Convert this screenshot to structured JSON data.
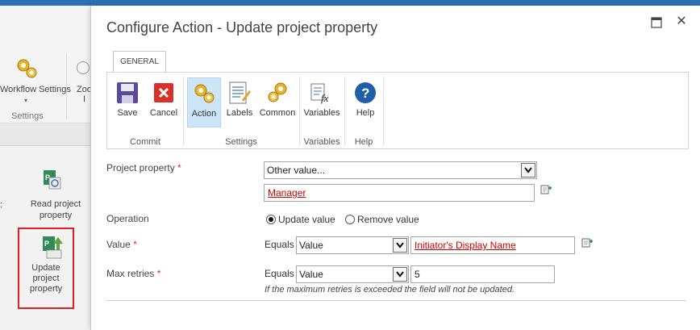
{
  "background": {
    "workflow_settings_label": "Workflow Settings",
    "zoom_label_line1": "Zoo",
    "zoom_label_line2": "I",
    "settings_group_label": "Settings",
    "panel_colon": ":",
    "read_project_property_label": "Read project property",
    "update_project_property_label": "Update project property",
    "highlight_color": "#e02020"
  },
  "dialog": {
    "title": "Configure Action - Update project property",
    "maximize_icon": "maximize-icon",
    "close_icon": "close-icon",
    "close_glyph": "✕"
  },
  "ribbon": {
    "tab": "GENERAL",
    "buttons": {
      "save": "Save",
      "cancel": "Cancel",
      "action": "Action",
      "labels": "Labels",
      "common": "Common",
      "variables": "Variables",
      "help": "Help"
    },
    "groups": {
      "commit": "Commit",
      "settings": "Settings",
      "variables": "Variables",
      "help": "Help"
    },
    "active_color": "#cde6f7"
  },
  "form": {
    "project_property": {
      "label": "Project property",
      "required_marker": "*",
      "selected": "Other value...",
      "value": "Manager"
    },
    "operation": {
      "label": "Operation",
      "options": [
        "Update value",
        "Remove value"
      ],
      "selected": "Update value"
    },
    "value": {
      "label": "Value",
      "required_marker": "*",
      "comparator": "Equals",
      "type_selected": "Value",
      "value": "Initiator's Display Name"
    },
    "max_retries": {
      "label": "Max retries",
      "required_marker": "*",
      "comparator": "Equals",
      "type_selected": "Value",
      "value": "5",
      "hint": "If the maximum retries is exceeded the field will not be updated."
    },
    "token_color": "#d00000"
  }
}
